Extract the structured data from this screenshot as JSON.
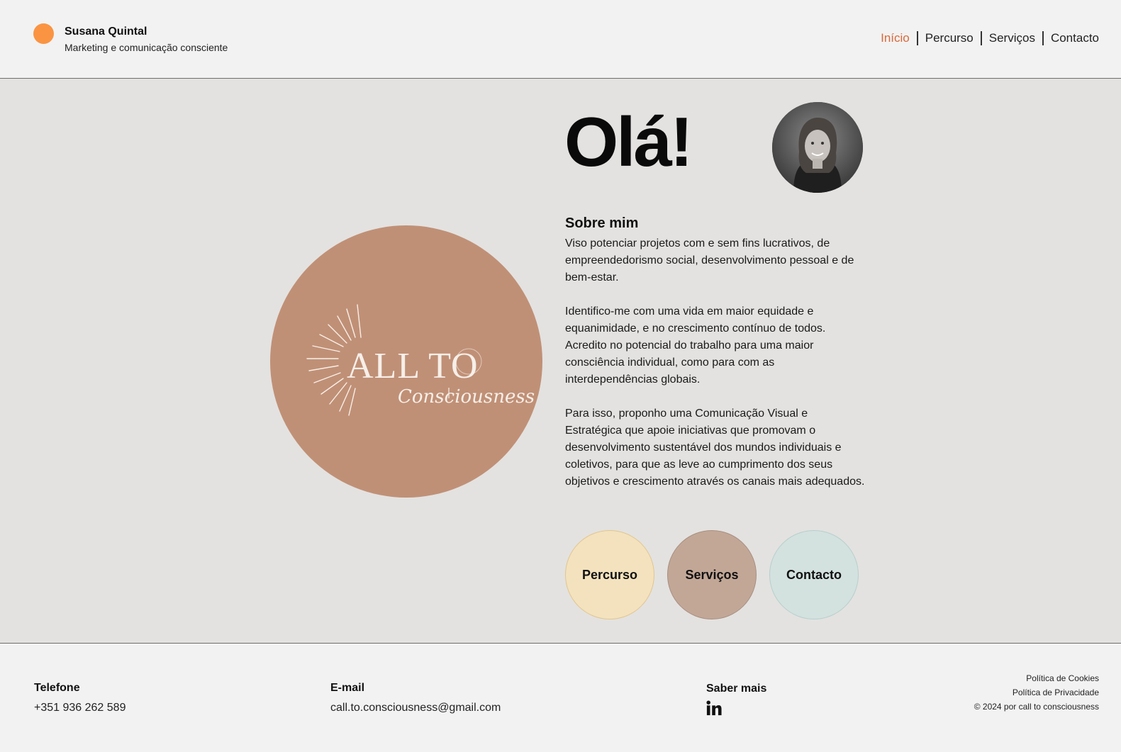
{
  "header": {
    "brand_name": "Susana Quintal",
    "brand_tagline": "Marketing e comunicação consciente",
    "nav": [
      {
        "label": "Início",
        "active": true
      },
      {
        "label": "Percurso",
        "active": false
      },
      {
        "label": "Serviços",
        "active": false
      },
      {
        "label": "Contacto",
        "active": false
      }
    ]
  },
  "hero": {
    "greeting": "Olá!",
    "logo_text_main": "ALL TO",
    "logo_text_script": "Consciousness",
    "about_title": "Sobre mim",
    "paragraphs": [
      "Viso potenciar projetos com e sem fins lucrativos, de empreendedorismo social, desenvolvimento pessoal e de bem-estar.",
      "Identifico-me com uma vida em maior equidade e equanimidade, e no crescimento contínuo de todos. Acredito no potencial do trabalho para uma maior consciência individual, como para com as interdependências globais.",
      "Para isso, proponho uma Comunicação Visual e Estratégica que apoie iniciativas que promovam o desenvolvimento sustentável dos mundos individuais e coletivos, para que as leve ao cumprimento dos seus objetivos e crescimento através os canais mais adequados."
    ],
    "buttons": {
      "percurso": "Percurso",
      "servicos": "Serviços",
      "contacto": "Contacto"
    }
  },
  "footer": {
    "phone_label": "Telefone",
    "phone_value": "+351 936 262 589",
    "email_label": "E-mail",
    "email_value": "call.to.consciousness@gmail.com",
    "more_label": "Saber mais",
    "cookies": "Política de Cookies",
    "privacy": "Política de Privacidade",
    "copyright": "© 2024 por call to consciousness"
  },
  "colors": {
    "accent_dot": "#fa9442",
    "nav_active": "#d9693b",
    "logo_bg": "#c09076",
    "btn_percurso": "#f3e2bd",
    "btn_servicos": "#c2a797",
    "btn_contacto": "#d3e1df"
  },
  "icons": [
    "linkedin-icon"
  ]
}
